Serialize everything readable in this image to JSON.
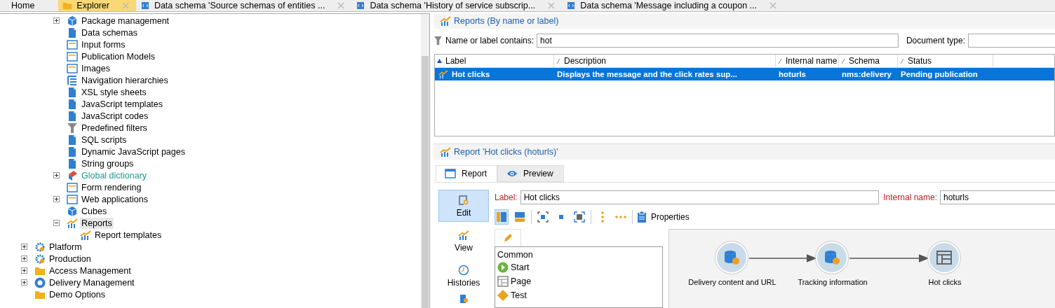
{
  "tabs": [
    {
      "label": "Home",
      "selected": false
    },
    {
      "label": "Explorer",
      "selected": true
    },
    {
      "label": "Data schema 'Source schemas of entities ...",
      "selected": false
    },
    {
      "label": "Data schema 'History of service subscrip...",
      "selected": false
    },
    {
      "label": "Data schema 'Message including a coupon ...",
      "selected": false
    }
  ],
  "tree": [
    {
      "children": [
        {
          "label": "Package management",
          "expanded": false,
          "selected": false,
          "highlighted": false
        },
        {
          "label": "Data schemas",
          "selected": false,
          "highlighted": false
        },
        {
          "label": "Input forms",
          "selected": false,
          "highlighted": false
        },
        {
          "label": "Publication Models",
          "selected": false,
          "highlighted": false
        },
        {
          "label": "Images",
          "selected": false,
          "highlighted": false
        },
        {
          "label": "Navigation hierarchies",
          "selected": false,
          "highlighted": false
        },
        {
          "label": "XSL style sheets",
          "selected": false,
          "highlighted": false
        },
        {
          "label": "JavaScript templates",
          "selected": false,
          "highlighted": false
        },
        {
          "label": "JavaScript codes",
          "selected": false,
          "highlighted": false
        },
        {
          "label": "Predefined filters",
          "selected": false,
          "highlighted": false
        },
        {
          "label": "SQL scripts",
          "selected": false,
          "highlighted": false
        },
        {
          "label": "Dynamic JavaScript pages",
          "selected": false,
          "highlighted": false
        },
        {
          "label": "String groups",
          "selected": false,
          "highlighted": false
        },
        {
          "label": "Global dictionary",
          "expanded": false,
          "selected": false,
          "highlighted": true
        },
        {
          "label": "Form rendering",
          "selected": false,
          "highlighted": false
        },
        {
          "label": "Web applications",
          "expanded": false,
          "selected": false,
          "highlighted": false
        },
        {
          "label": "Cubes",
          "selected": false,
          "highlighted": false
        },
        {
          "label": "Reports",
          "expanded": true,
          "selected": true,
          "highlighted": false,
          "children": [
            {
              "label": "Report templates",
              "selected": false,
              "highlighted": false
            }
          ]
        }
      ]
    },
    {
      "label": "Platform",
      "expanded": false,
      "selected": false,
      "highlighted": false
    },
    {
      "label": "Production",
      "expanded": false,
      "selected": false,
      "highlighted": false
    },
    {
      "label": "Access Management",
      "expanded": false,
      "selected": false,
      "highlighted": false
    },
    {
      "label": "Delivery Management",
      "expanded": false,
      "selected": false,
      "highlighted": false
    },
    {
      "label": "Demo Options",
      "selected": false,
      "highlighted": false
    }
  ],
  "list_panel": {
    "title": "Reports (By name or label)",
    "filter": {
      "label": "Name or label contains:",
      "value": "hot"
    },
    "document_type": {
      "label": "Document type:"
    },
    "columns": [
      {
        "label": "Label",
        "sorted": true
      },
      {
        "label": "Description",
        "sorted": false
      },
      {
        "label": "Internal name",
        "sorted": false
      },
      {
        "label": "Schema",
        "sorted": false
      },
      {
        "label": "Status",
        "sorted": false
      }
    ],
    "rows": [
      {
        "selected": true,
        "cells": [
          "Hot clicks",
          "Displays the message and the click rates sup...",
          "hoturls",
          "nms:delivery",
          "Pending publication"
        ]
      }
    ]
  },
  "detail_panel": {
    "title": "Report 'Hot clicks (hoturls)'",
    "tabs": [
      {
        "label": "Report",
        "selected": true
      },
      {
        "label": "Preview",
        "selected": false
      }
    ],
    "nav": [
      {
        "label": "Edit",
        "selected": true
      },
      {
        "label": "View",
        "selected": false
      },
      {
        "label": "Histories",
        "selected": false
      }
    ],
    "label_field": {
      "label": "Label:",
      "value": "Hot clicks"
    },
    "internal_name_field": {
      "label": "Internal name:",
      "value": "hoturls"
    },
    "toolbar": {
      "properties": "Properties"
    },
    "palette": {
      "group": "Common",
      "items": [
        {
          "label": "Start",
          "kind": "start"
        },
        {
          "label": "Page",
          "kind": "page"
        },
        {
          "label": "Test",
          "kind": "test"
        }
      ]
    },
    "diagram": {
      "nodes": [
        {
          "label": "Delivery content and URL",
          "kind": "query"
        },
        {
          "label": "Tracking information",
          "kind": "query"
        },
        {
          "label": "Hot clicks",
          "kind": "page"
        }
      ]
    }
  }
}
